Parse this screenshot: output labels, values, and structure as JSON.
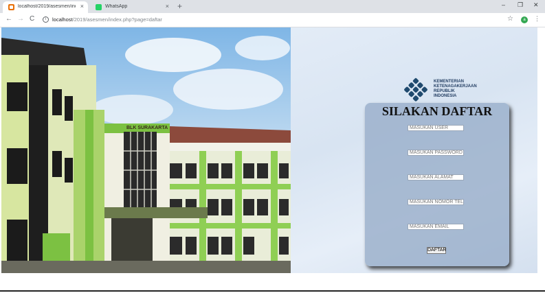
{
  "browser": {
    "tabs": [
      {
        "title": "localhost/2019/asesmen/index.p",
        "active": true,
        "favicon": "site-favicon-icon"
      },
      {
        "title": "WhatsApp",
        "active": false,
        "favicon": "whatsapp-icon"
      }
    ],
    "address_host": "localhost",
    "address_path": "/2019/asesmen/index.php?page=daftar",
    "profile_initial": "a",
    "window_controls": {
      "minimize": "–",
      "maximize": "❐",
      "close": "✕"
    },
    "icons": {
      "back": "←",
      "forward": "→",
      "reload": "C",
      "star": "☆",
      "menu": "⋮",
      "new_tab": "+",
      "tab_close": "×",
      "info": "i"
    }
  },
  "page": {
    "logo_lines": [
      "KEMENTERIAN",
      "KETENAGAKERJAAN",
      "REPUBLIK",
      "INDONESIA"
    ],
    "building_sign": "BLK SURAKARTA",
    "form": {
      "title": "SILAKAN DAFTAR",
      "fields": [
        {
          "placeholder": "MASUKAN USER"
        },
        {
          "placeholder": "MASUKAN PASSWORD"
        },
        {
          "placeholder": "MASUKAN ALAMAT"
        },
        {
          "placeholder": "MASUKAN NOMOR TELP"
        },
        {
          "placeholder": "MASUKAN EMAIL"
        }
      ],
      "submit_label": "DAFTAR"
    }
  },
  "colors": {
    "logo": "#1f4a6e",
    "building_green": "#7cc142",
    "form_bg": "#96acc8"
  }
}
